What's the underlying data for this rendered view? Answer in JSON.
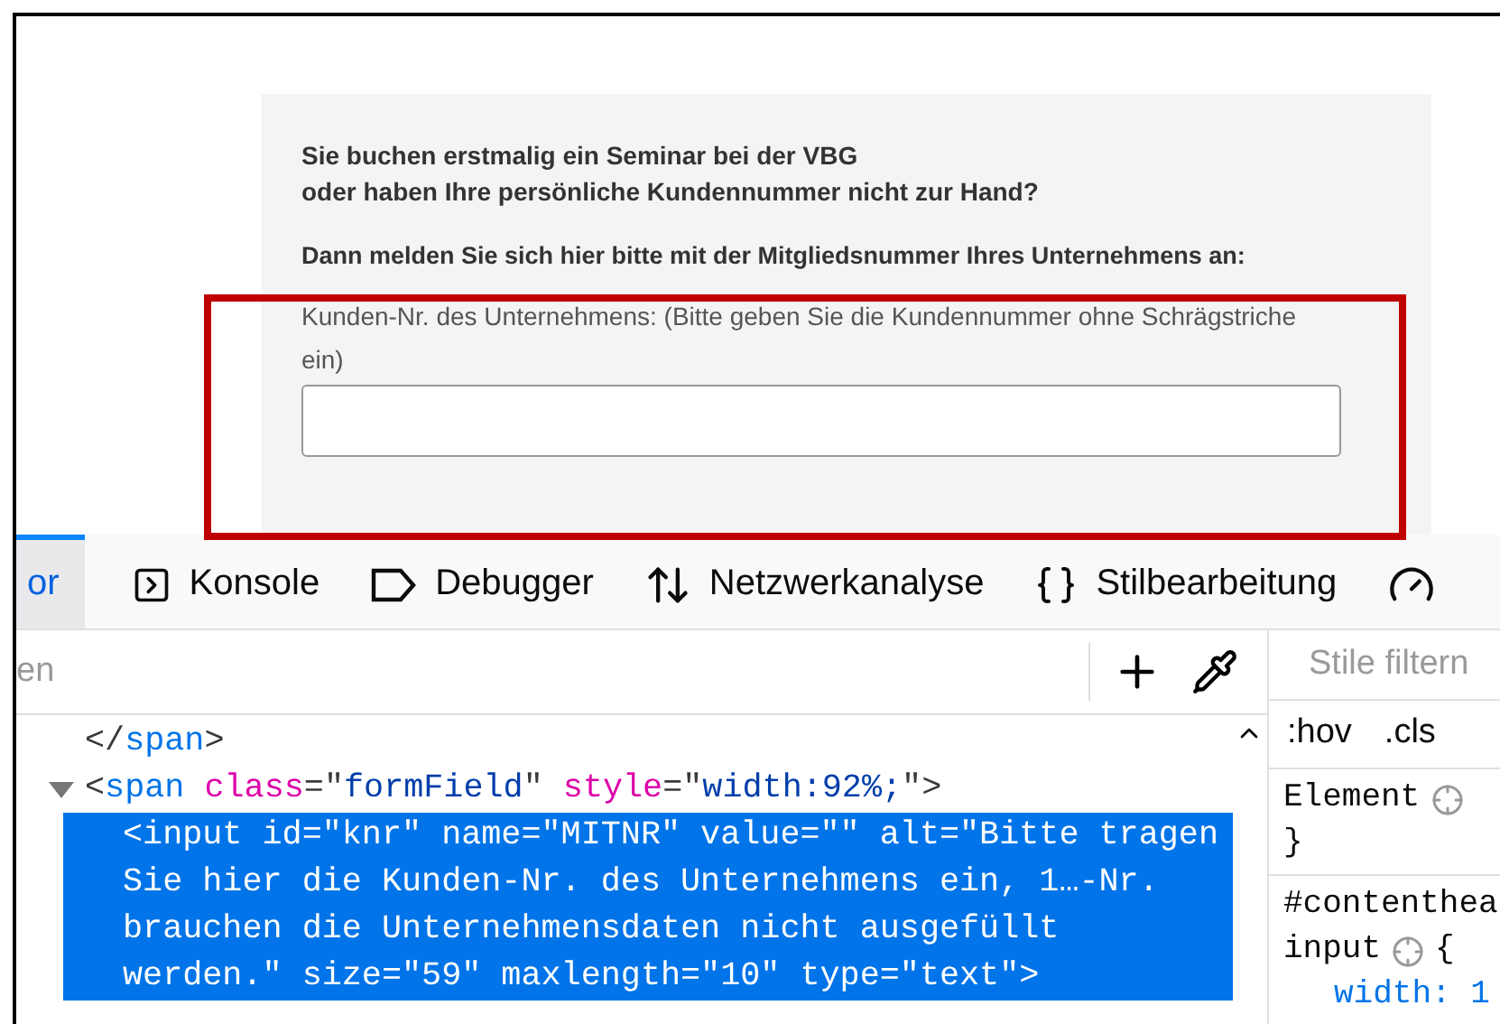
{
  "page": {
    "heading_lines": [
      "Sie buchen erstmalig ein Seminar bei der VBG",
      "oder haben Ihre persönliche Kundennummer nicht zur Hand?"
    ],
    "instruction": "Dann melden Sie sich hier bitte mit der Mitgliedsnummer Ihres Unternehmens an:",
    "field": {
      "label": "Kunden-Nr. des Unternehmens: (Bitte geben Sie die Kundennummer ohne Schrägstriche ein)",
      "highlighted": true
    }
  },
  "devtools": {
    "tabs": [
      {
        "kind": "inspector",
        "label": "or",
        "selected": true
      },
      {
        "kind": "console",
        "label": "Konsole",
        "selected": false
      },
      {
        "kind": "debugger",
        "label": "Debugger",
        "selected": false
      },
      {
        "kind": "network",
        "label": "Netzwerkanalyse",
        "selected": false
      },
      {
        "kind": "style",
        "label": "Stilbearbeitung",
        "selected": false
      },
      {
        "kind": "performance",
        "selected": false
      }
    ],
    "markup": {
      "search_placeholder": "en",
      "nodes": [
        {
          "selected": false,
          "tokens": [
            {
              "kind": "punct",
              "t": "</"
            },
            {
              "kind": "tag",
              "t": "span"
            },
            {
              "kind": "punct",
              "t": ">"
            }
          ]
        },
        {
          "selected": false,
          "expanded": true,
          "tokens": [
            {
              "kind": "punct",
              "t": "<"
            },
            {
              "kind": "tag",
              "t": "span"
            },
            {
              "kind": "attr",
              "t": " class"
            },
            {
              "kind": "punct",
              "t": "=\""
            },
            {
              "kind": "value",
              "t": "formField"
            },
            {
              "kind": "punct",
              "t": "\""
            },
            {
              "kind": "attr",
              "t": " style"
            },
            {
              "kind": "punct",
              "t": "=\""
            },
            {
              "kind": "value",
              "t": "width:92%;"
            },
            {
              "kind": "punct",
              "t": "\">"
            }
          ]
        },
        {
          "selected": true,
          "tokens": [
            {
              "t": "<input id=\"knr\" name=\"MITNR\" value=\"\" alt=\"Bitte tragen Sie hier die Kunden-Nr. des Unternehmens ein, 1…-Nr. brauchen die Unternehmensdaten nicht ausgefüllt werden.\" size=\"59\" maxlength=\"10\" type=\"text\">"
            }
          ]
        }
      ]
    },
    "rules": {
      "filter_placeholder": "Stile filtern",
      "toggles": [
        ":hov",
        ".cls"
      ],
      "blocks": [
        {
          "selector": "Element",
          "close": "}"
        },
        {
          "selector": "#contenthea",
          "selector2": "input",
          "open": "{",
          "decl": "width: 1"
        }
      ]
    }
  }
}
